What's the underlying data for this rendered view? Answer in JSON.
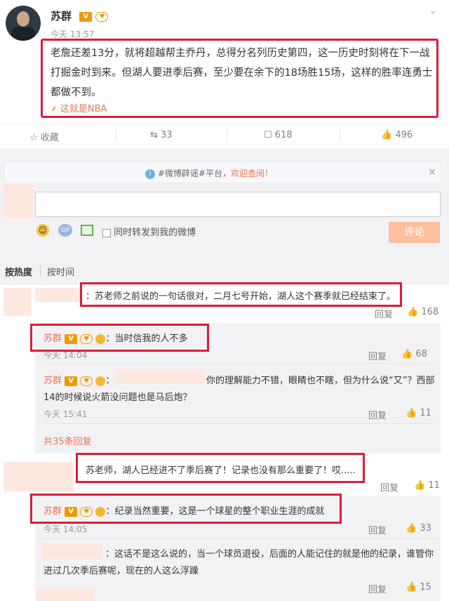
{
  "post": {
    "author": "苏群",
    "time": "今天 13:57",
    "text": "老詹还差13分，就将超越帮主乔丹，总得分名列历史第四，这一历史时刻将在下一战打掘金时到来。但湖人要进季后赛，至少要在余下的18场胜15场，这样的胜率连勇士都做不到。",
    "tag": "这就是NBA",
    "badge_v": "V"
  },
  "actions": {
    "favorite_label": "收藏",
    "repost_count": "33",
    "comment_count": "618",
    "like_count": "496"
  },
  "notice": {
    "text_pre": "#微博辟谣#平台，",
    "text_link": "欢迎查阅！"
  },
  "composer": {
    "checkbox_label": "同时转发到我的微博",
    "submit_label": "评论",
    "icon_gif": "GIF"
  },
  "sort": {
    "hot": "按热度",
    "time": "按时间"
  },
  "comments": [
    {
      "text": "：苏老师之前说的一句话很对，二月七号开始，湖人这个赛季就已经结束了。",
      "reply": "回复",
      "likes": "168"
    },
    {
      "author": "苏群",
      "text": "：当时信我的人不多",
      "time": "今天 14:04",
      "reply": "回复",
      "likes": "68"
    },
    {
      "author": "苏群",
      "text": "你的理解能力不错，眼睛也不瞎，但为什么说“又”？西部14的时候说火箭没问题也是马后炮？",
      "time": "今天 15:41",
      "reply": "回复",
      "likes": "11"
    },
    {
      "more": "共35条回复"
    },
    {
      "text": "苏老师，湖人已经进不了季后赛了！记录也没有那么重要了！哎.....",
      "reply": "回复",
      "likes": "11"
    },
    {
      "author": "苏群",
      "text": "：纪录当然重要，这是一个球星的整个职业生涯的成就",
      "time": "今天 14:05",
      "reply": "回复",
      "likes": "33"
    },
    {
      "text": "：这话不是这么说的，当一个球员退役，后面的人能记住的就是他的纪录，谁管你进过几次季后赛呢，现在的人这么浮躁",
      "reply": "回复",
      "likes": "15"
    }
  ]
}
